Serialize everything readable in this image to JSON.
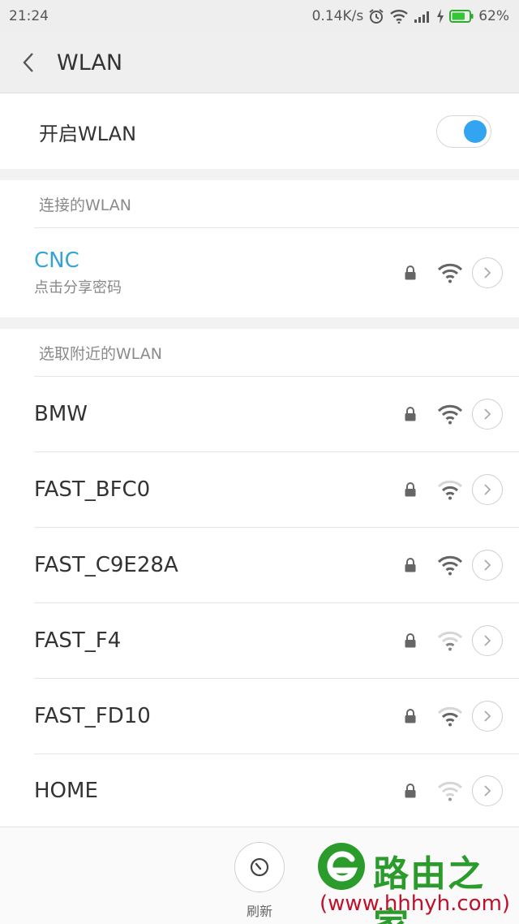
{
  "status_bar": {
    "time": "21:24",
    "speed": "0.14K/s",
    "battery": "62%",
    "icons": [
      "alarm-icon",
      "wifi-icon",
      "signal-icon",
      "charging-icon",
      "battery-icon"
    ]
  },
  "app_bar": {
    "title": "WLAN"
  },
  "toggle": {
    "label": "开启WLAN",
    "on": true
  },
  "connected_section": {
    "header": "连接的WLAN",
    "network": {
      "name": "CNC",
      "subtitle": "点击分享密码",
      "locked": true
    }
  },
  "nearby_section": {
    "header": "选取附近的WLAN",
    "networks": [
      {
        "name": "BMW",
        "locked": true
      },
      {
        "name": "FAST_BFC0",
        "locked": true
      },
      {
        "name": "FAST_C9E28A",
        "locked": true
      },
      {
        "name": "FAST_F4",
        "locked": true
      },
      {
        "name": "FAST_FD10",
        "locked": true
      },
      {
        "name": "HOME",
        "locked": true
      }
    ]
  },
  "bottom_bar": {
    "refresh_label": "刷新"
  },
  "watermark": {
    "title": "路由之家",
    "url": "(www.hhhyh.com)"
  },
  "colors": {
    "accent": "#33a4f0",
    "connected_text": "#33a4d8",
    "watermark_green": "#2b9b2b",
    "watermark_red": "#c0102a"
  }
}
